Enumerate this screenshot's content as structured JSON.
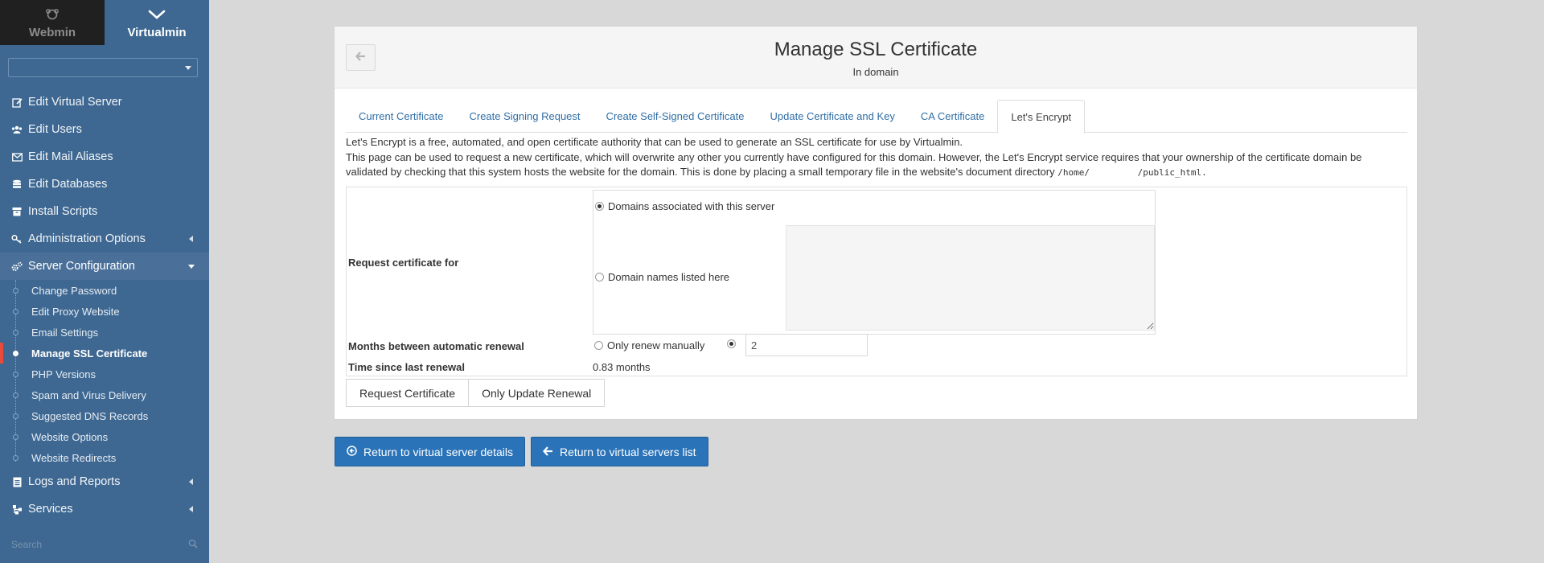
{
  "top_tabs": {
    "webmin": {
      "label": "Webmin",
      "icon": "webmin-logo-icon"
    },
    "virtualmin": {
      "label": "Virtualmin",
      "icon": "virtualmin-logo-icon"
    }
  },
  "domain_select": {
    "value": ""
  },
  "menu": {
    "edit_virtual_server": "Edit Virtual Server",
    "edit_users": "Edit Users",
    "edit_mail_aliases": "Edit Mail Aliases",
    "edit_databases": "Edit Databases",
    "install_scripts": "Install Scripts",
    "administration_options": "Administration Options",
    "server_configuration": "Server Configuration",
    "submenu": [
      "Change Password",
      "Edit Proxy Website",
      "Email Settings",
      "Manage SSL Certificate",
      "PHP Versions",
      "Spam and Virus Delivery",
      "Suggested DNS Records",
      "Website Options",
      "Website Redirects"
    ],
    "logs_and_reports": "Logs and Reports",
    "services": "Services"
  },
  "search": {
    "placeholder": "Search"
  },
  "header": {
    "title": "Manage SSL Certificate",
    "subtitle": "In domain"
  },
  "tabs": [
    "Current Certificate",
    "Create Signing Request",
    "Create Self-Signed Certificate",
    "Update Certificate and Key",
    "CA Certificate",
    "Let's Encrypt"
  ],
  "description": {
    "line1": "Let's Encrypt is a free, automated, and open certificate authority that can be used to generate an SSL certificate for use by Virtualmin.",
    "line2": "This page can be used to request a new certificate, which will overwrite any other you currently have configured for this domain. However, the Let's Encrypt service requires that your ownership of the certificate domain be",
    "line3": "validated by checking that this system hosts the website for the domain. This is done by placing a small temporary file in the website's document directory",
    "path_start": "/home/",
    "path_end": "/public_html",
    "period": "."
  },
  "form": {
    "request_label": "Request certificate for",
    "option_associated": "Domains associated with this server",
    "option_listed": "Domain names listed here",
    "domains_text": "",
    "months_label": "Months between automatic renewal",
    "only_manual": "Only renew manually",
    "months_value": "2",
    "time_label": "Time since last renewal",
    "time_value": "0.83 months"
  },
  "buttons": {
    "request": "Request Certificate",
    "update_renewal": "Only Update Renewal",
    "return_details": "Return to virtual server details",
    "return_list": "Return to virtual servers list"
  },
  "colors": {
    "sidebar": "#3e6892",
    "accent_active": "#e84b3c",
    "primary_button": "#2a73b8",
    "link": "#2f6ea6"
  }
}
